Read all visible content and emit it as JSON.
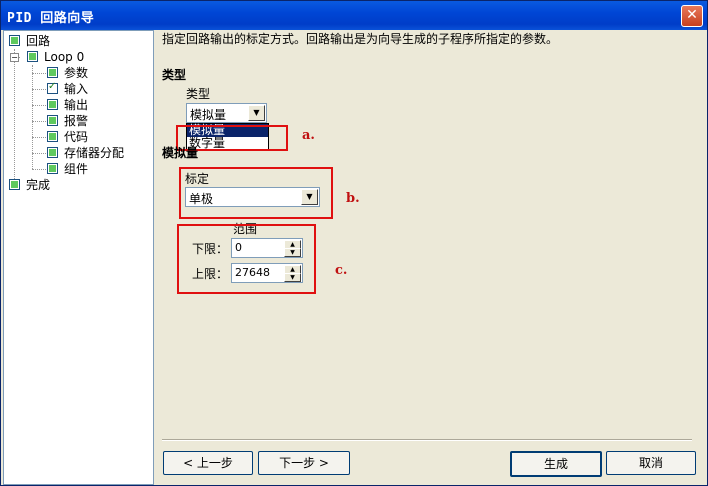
{
  "window": {
    "title": "PID 回路向导",
    "close_glyph": "✕"
  },
  "tree": {
    "root": "回路",
    "loop": "Loop 0",
    "items": [
      {
        "label": "参数",
        "checked": false
      },
      {
        "label": "输入",
        "checked": true
      },
      {
        "label": "输出",
        "checked": false
      },
      {
        "label": "报警",
        "checked": false
      },
      {
        "label": "代码",
        "checked": false
      },
      {
        "label": "存储器分配",
        "checked": false
      },
      {
        "label": "组件",
        "checked": false
      }
    ],
    "finish": "完成",
    "expander_glyph": "−"
  },
  "main": {
    "description": "指定回路输出的标定方式。回路输出是为向导生成的子程序所指定的参数。",
    "type_section": "类型",
    "type_label": "类型",
    "type_value": "模拟量",
    "type_options": [
      "模拟量",
      "数字量"
    ],
    "analog_section": "模拟量",
    "scale_label": "标定",
    "scale_value": "单极",
    "range_label": "范围",
    "lower_label": "下限：",
    "lower_value": "0",
    "upper_label": "上限：",
    "upper_value": "27648",
    "annotations": {
      "a": "a.",
      "b": "b.",
      "c": "c."
    },
    "dropdown_glyph": "▼",
    "spin_up_glyph": "▲",
    "spin_down_glyph": "▼"
  },
  "buttons": {
    "prev": "< 上一步",
    "next": "下一步 >",
    "generate": "生成",
    "cancel": "取消"
  },
  "colors": {
    "annotation_red": "#e01010",
    "title_bar": "#0046d5",
    "selection": "#0a246a"
  }
}
